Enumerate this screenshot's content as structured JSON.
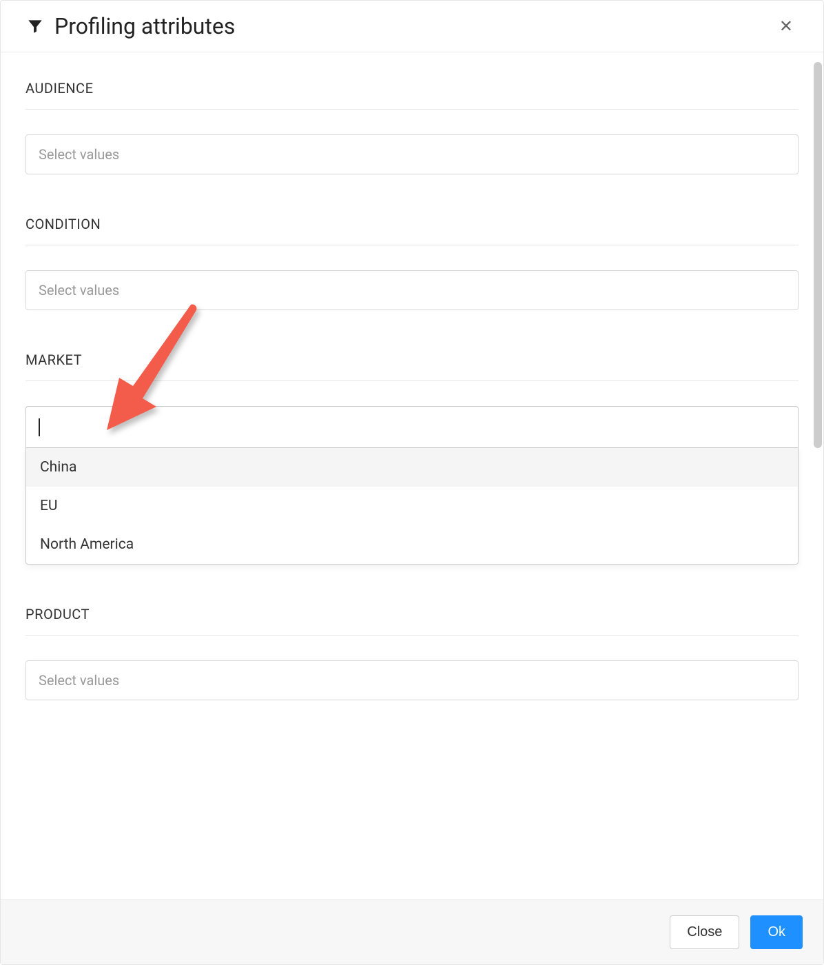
{
  "header": {
    "title": "Profiling attributes"
  },
  "sections": {
    "audience": {
      "label": "AUDIENCE",
      "placeholder": "Select values"
    },
    "condition": {
      "label": "CONDITION",
      "placeholder": "Select values"
    },
    "market": {
      "label": "MARKET",
      "options": [
        "China",
        "EU",
        "North America"
      ]
    },
    "product": {
      "label": "PRODUCT",
      "placeholder": "Select values"
    }
  },
  "footer": {
    "close_label": "Close",
    "ok_label": "Ok"
  },
  "colors": {
    "primary": "#1e90ff",
    "annotation_arrow": "#f35c4a"
  }
}
